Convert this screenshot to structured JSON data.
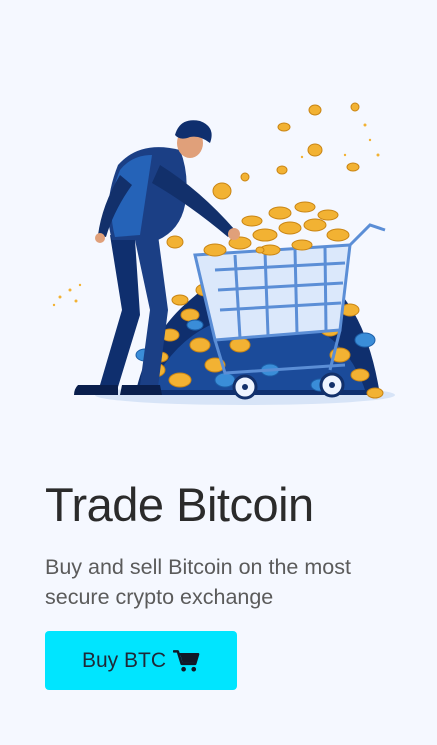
{
  "hero": {
    "title": "Trade Bitcoin",
    "subtitle": "Buy and sell Bitcoin on the most secure crypto exchange",
    "cta_label": "Buy BTC",
    "cta_icon": "shopping-cart-icon",
    "illustration": "man-pushing-shopping-cart-full-of-coins"
  },
  "colors": {
    "page_background": "#f5f8ff",
    "accent": "#00e5ff",
    "coin_gold": "#f2b233",
    "navy": "#12306b",
    "blue": "#2563b8"
  }
}
